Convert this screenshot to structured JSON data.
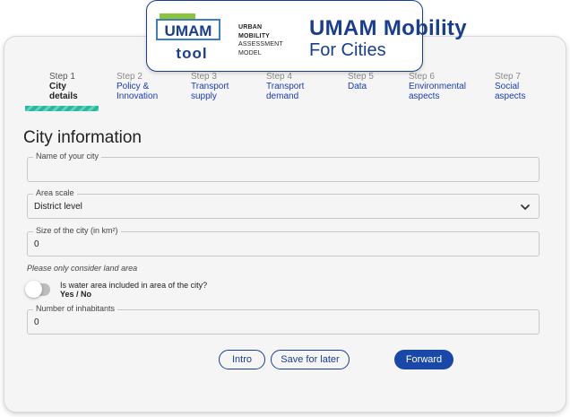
{
  "header": {
    "logo_text": "UMAM",
    "logo_tool": "tool",
    "subtitle_lines": [
      "URBAN",
      "MOBILITY",
      "ASSESSMENT",
      "MODEL"
    ],
    "title": "UMAM Mobility",
    "title2": "For Cities",
    "brand_color": "#1a3e8f"
  },
  "steps": [
    {
      "num": "Step 1",
      "label_lines": [
        "City",
        "details"
      ],
      "active": true
    },
    {
      "num": "Step 2",
      "label_lines": [
        "Policy &",
        "Innovation"
      ]
    },
    {
      "num": "Step 3",
      "label_lines": [
        "Transport",
        "supply"
      ]
    },
    {
      "num": "Step 4",
      "label_lines": [
        "Transport",
        "demand"
      ]
    },
    {
      "num": "Step 5",
      "label_lines": [
        "Data",
        ""
      ]
    },
    {
      "num": "Step 6",
      "label_lines": [
        "Environmental",
        "aspects"
      ]
    },
    {
      "num": "Step 7",
      "label_lines": [
        "Social",
        "aspects"
      ]
    }
  ],
  "page_title": "City information",
  "fields": {
    "city_name": {
      "label": "Name of your city",
      "value": ""
    },
    "area_scale": {
      "label": "Area scale",
      "value": "District level"
    },
    "city_size": {
      "label": "Size of the city (in km²)",
      "value": "0"
    },
    "inhabitants": {
      "label": "Number of inhabitants",
      "value": "0"
    }
  },
  "note": "Please only consider land area",
  "water_toggle": {
    "question": "Is water area included in area of the city?",
    "options": "Yes / No",
    "checked": false
  },
  "buttons": {
    "intro": "Intro",
    "save": "Save for later",
    "forward": "Forward"
  }
}
